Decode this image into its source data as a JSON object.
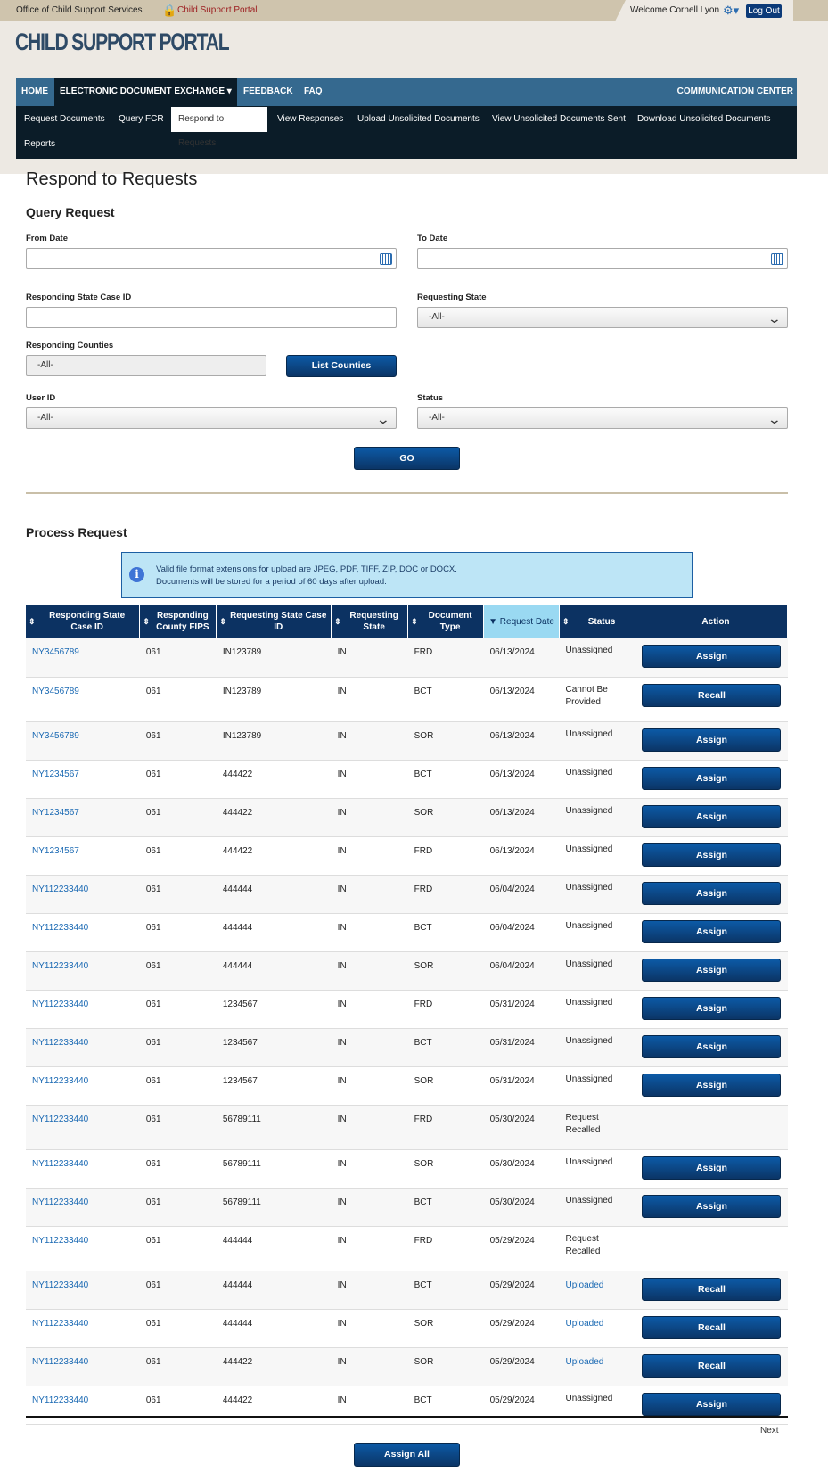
{
  "topbar": {
    "org": "Office of Child Support Services",
    "portal": "Child Support Portal",
    "welcome": "Welcome Cornell Lyon",
    "logout": "Log Out"
  },
  "header": {
    "title": "CHILD SUPPORT PORTAL"
  },
  "nav": {
    "items": [
      "HOME",
      "ELECTRONIC DOCUMENT EXCHANGE",
      "FEEDBACK",
      "FAQ"
    ],
    "right": "COMMUNICATION CENTER"
  },
  "subnav": {
    "items": [
      "Request Documents",
      "Query FCR",
      "Respond to Requests",
      "View Responses",
      "Upload Unsolicited Documents",
      "View Unsolicited Documents Sent",
      "Download Unsolicited Documents",
      "Reports"
    ],
    "active": "Respond to Requests"
  },
  "page": {
    "title": "Respond to Requests",
    "query_heading": "Query Request",
    "process_heading": "Process Request"
  },
  "form": {
    "from_date": {
      "label": "From Date",
      "value": ""
    },
    "to_date": {
      "label": "To Date",
      "value": ""
    },
    "case_id": {
      "label": "Responding State Case ID",
      "value": ""
    },
    "requesting_state": {
      "label": "Requesting State",
      "value": "-All-"
    },
    "counties": {
      "label": "Responding Counties",
      "value": "-All-"
    },
    "list_counties": "List Counties",
    "user_id": {
      "label": "User ID",
      "value": "-All-"
    },
    "status": {
      "label": "Status",
      "value": "-All-"
    },
    "go": "GO"
  },
  "info": {
    "line1": "Valid file format extensions for upload are JPEG, PDF, TIFF, ZIP, DOC or DOCX.",
    "line2": "Documents will be stored for a period of 60 days after upload."
  },
  "table": {
    "columns": [
      "Responding State Case ID",
      "Responding County FIPS",
      "Requesting State Case ID",
      "Requesting State",
      "Document Type",
      "Request Date",
      "Status",
      "Action"
    ],
    "sorted_column": "Request Date",
    "sort_direction": "descending",
    "rows": [
      [
        "NY3456789",
        "061",
        "IN123789",
        "IN",
        "FRD",
        "06/13/2024",
        "Unassigned",
        "Assign"
      ],
      [
        "NY3456789",
        "061",
        "IN123789",
        "IN",
        "BCT",
        "06/13/2024",
        "Cannot Be Provided",
        "Recall"
      ],
      [
        "NY3456789",
        "061",
        "IN123789",
        "IN",
        "SOR",
        "06/13/2024",
        "Unassigned",
        "Assign"
      ],
      [
        "NY1234567",
        "061",
        "444422",
        "IN",
        "BCT",
        "06/13/2024",
        "Unassigned",
        "Assign"
      ],
      [
        "NY1234567",
        "061",
        "444422",
        "IN",
        "SOR",
        "06/13/2024",
        "Unassigned",
        "Assign"
      ],
      [
        "NY1234567",
        "061",
        "444422",
        "IN",
        "FRD",
        "06/13/2024",
        "Unassigned",
        "Assign"
      ],
      [
        "NY112233440",
        "061",
        "444444",
        "IN",
        "FRD",
        "06/04/2024",
        "Unassigned",
        "Assign"
      ],
      [
        "NY112233440",
        "061",
        "444444",
        "IN",
        "BCT",
        "06/04/2024",
        "Unassigned",
        "Assign"
      ],
      [
        "NY112233440",
        "061",
        "444444",
        "IN",
        "SOR",
        "06/04/2024",
        "Unassigned",
        "Assign"
      ],
      [
        "NY112233440",
        "061",
        "1234567",
        "IN",
        "FRD",
        "05/31/2024",
        "Unassigned",
        "Assign"
      ],
      [
        "NY112233440",
        "061",
        "1234567",
        "IN",
        "BCT",
        "05/31/2024",
        "Unassigned",
        "Assign"
      ],
      [
        "NY112233440",
        "061",
        "1234567",
        "IN",
        "SOR",
        "05/31/2024",
        "Unassigned",
        "Assign"
      ],
      [
        "NY112233440",
        "061",
        "56789111",
        "IN",
        "FRD",
        "05/30/2024",
        "Request Recalled",
        ""
      ],
      [
        "NY112233440",
        "061",
        "56789111",
        "IN",
        "SOR",
        "05/30/2024",
        "Unassigned",
        "Assign"
      ],
      [
        "NY112233440",
        "061",
        "56789111",
        "IN",
        "BCT",
        "05/30/2024",
        "Unassigned",
        "Assign"
      ],
      [
        "NY112233440",
        "061",
        "444444",
        "IN",
        "FRD",
        "05/29/2024",
        "Request Recalled",
        ""
      ],
      [
        "NY112233440",
        "061",
        "444444",
        "IN",
        "BCT",
        "05/29/2024",
        "Uploaded",
        "Recall"
      ],
      [
        "NY112233440",
        "061",
        "444444",
        "IN",
        "SOR",
        "05/29/2024",
        "Uploaded",
        "Recall"
      ],
      [
        "NY112233440",
        "061",
        "444422",
        "IN",
        "SOR",
        "05/29/2024",
        "Uploaded",
        "Recall"
      ],
      [
        "NY112233440",
        "061",
        "444422",
        "IN",
        "BCT",
        "05/29/2024",
        "Unassigned",
        "Assign"
      ]
    ]
  },
  "pagination": {
    "next": "Next"
  },
  "assign_all": "Assign All",
  "colors": {
    "nav": "#35698f",
    "subnav": "#0b1c28",
    "table_header": "#0c3262",
    "sorted_header": "#9ad9f2",
    "button": "#0b4a8c",
    "link": "#1a69b3",
    "info_bg": "#bde5f6"
  }
}
